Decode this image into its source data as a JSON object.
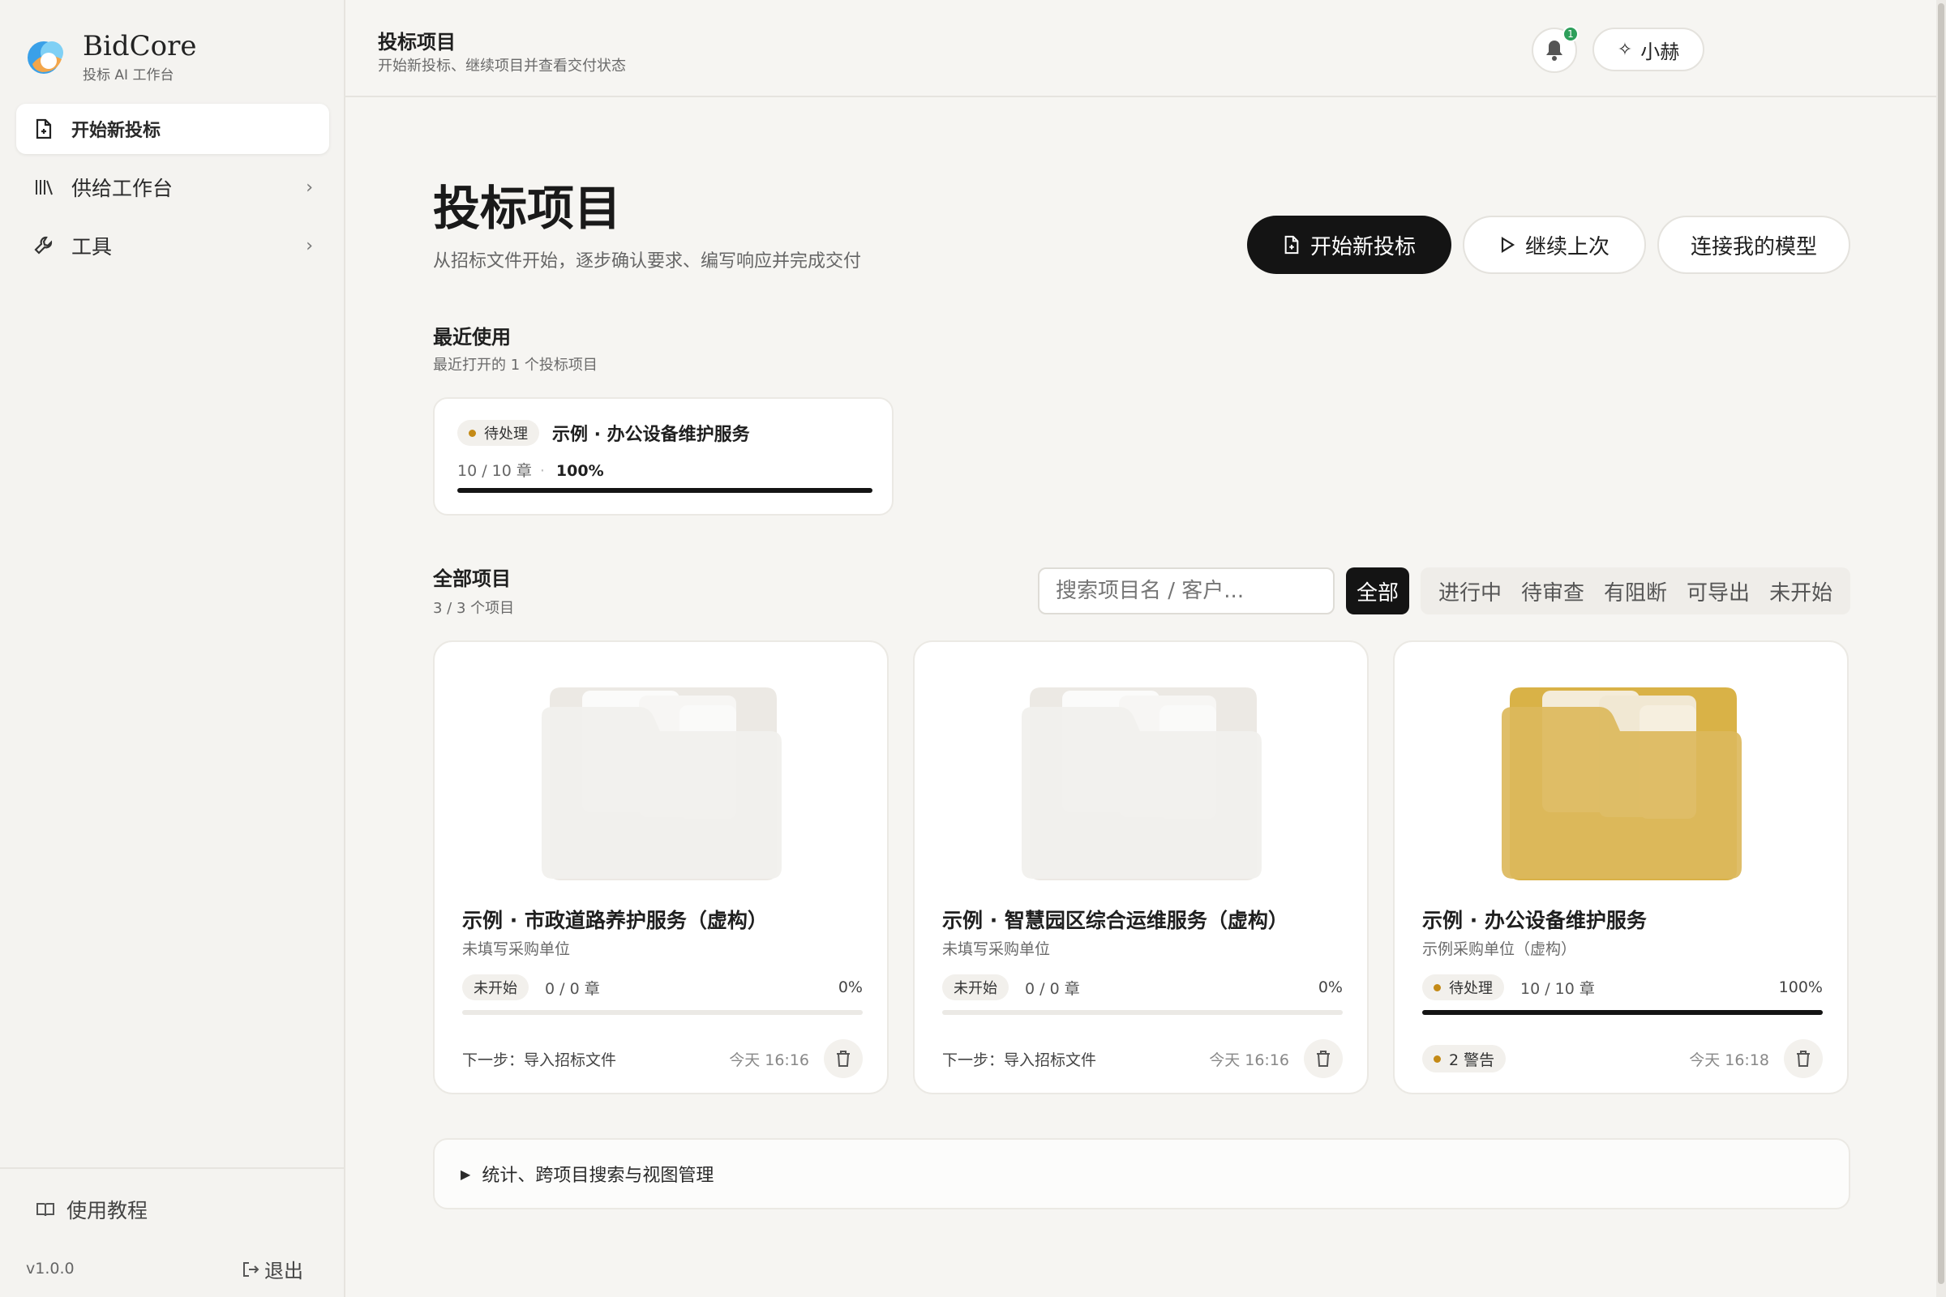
{
  "brand": {
    "name": "BidCore",
    "subtitle": "投标 AI 工作台"
  },
  "sidebar": {
    "items": [
      {
        "label": "开始新投标",
        "icon": "new-file-icon",
        "active": true
      },
      {
        "label": "供给工作台",
        "icon": "library-icon",
        "expandable": true
      },
      {
        "label": "工具",
        "icon": "wrench-icon",
        "expandable": true
      }
    ],
    "tutorial": "使用教程",
    "version": "v1.0.0",
    "logout": "退出"
  },
  "header": {
    "title": "投标项目",
    "subtitle": "开始新投标、继续项目并查看交付状态",
    "notification_count": "1",
    "user": "小赫"
  },
  "main": {
    "title": "投标项目",
    "subtitle": "从招标文件开始，逐步确认要求、编写响应并完成交付",
    "actions": {
      "new_bid": "开始新投标",
      "continue": "继续上次",
      "connect_model": "连接我的模型"
    },
    "recent": {
      "title": "最近使用",
      "subtitle": "最近打开的 1 个投标项目",
      "card": {
        "status": "待处理",
        "name": "示例 · 办公设备维护服务",
        "chapters": "10 / 10 章",
        "percent": "100%",
        "progress": 1.0
      }
    },
    "all": {
      "title": "全部项目",
      "subtitle": "3 / 3 个项目",
      "search_placeholder": "搜索项目名 / 客户...",
      "filters": [
        "全部",
        "进行中",
        "待审查",
        "有阻断",
        "可导出",
        "未开始"
      ],
      "projects": [
        {
          "title": "示例 · 市政道路养护服务（虚构）",
          "client": "未填写采购单位",
          "status": "未开始",
          "chapters": "0 / 0 章",
          "percent": "0%",
          "progress": 0,
          "next": "下一步：导入招标文件",
          "time": "今天 16:16"
        },
        {
          "title": "示例 · 智慧园区综合运维服务（虚构）",
          "client": "未填写采购单位",
          "status": "未开始",
          "chapters": "0 / 0 章",
          "percent": "0%",
          "progress": 0,
          "next": "下一步：导入招标文件",
          "time": "今天 16:16"
        },
        {
          "title": "示例 · 办公设备维护服务",
          "client": "示例采购单位（虚构）",
          "status": "待处理",
          "chapters": "10 / 10 章",
          "percent": "100%",
          "progress": 1.0,
          "warning": "2 警告",
          "time": "今天 16:18"
        }
      ]
    },
    "collapse_label": "统计、跨项目搜索与视图管理"
  },
  "colors": {
    "accent_dark": "#141414",
    "pending_dot": "#c48a16",
    "badge_green": "#2e9f5b",
    "folder_gold": "#d8b34e"
  }
}
